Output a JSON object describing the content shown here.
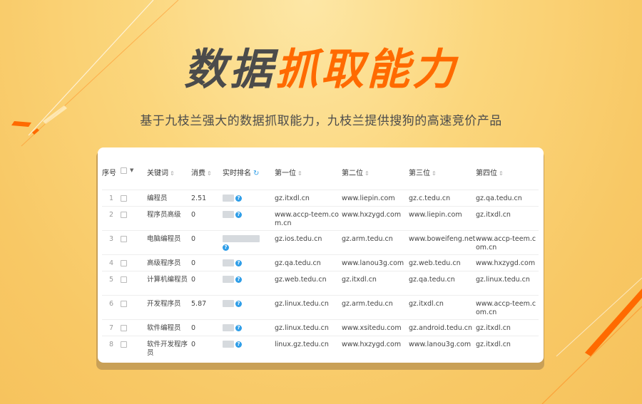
{
  "headline": {
    "dark": "数据",
    "orange": "抓取能力"
  },
  "subtitle": "基于九枝兰强大的数据抓取能力，九枝兰提供搜狗的高速竞价产品",
  "colors": {
    "accent": "#ff6a00",
    "info": "#2f9ee8",
    "card_shadow": "#c9a057"
  },
  "table": {
    "headers": {
      "index": "序号",
      "keyword": "关键词",
      "cost": "消费",
      "rank": "实时排名",
      "first": "第一位",
      "second": "第二位",
      "third": "第三位",
      "fourth": "第四位"
    },
    "sort_icon": "⇕",
    "refresh_icon": "refresh-icon",
    "question_icon": "question-icon",
    "rows": [
      {
        "index": "1",
        "keyword": "编程员",
        "cost": "2.51",
        "first": "gz.itxdl.cn",
        "second": "www.liepin.com",
        "third": "gz.c.tedu.cn",
        "fourth": "gz.qa.tedu.cn"
      },
      {
        "index": "2",
        "keyword": "程序员高级",
        "cost": "0",
        "first": "www.accp-teem.com.cn",
        "second": "www.hxzygd.com",
        "third": "www.liepin.com",
        "fourth": "gz.itxdl.cn"
      },
      {
        "index": "3",
        "keyword": "电脑编程员",
        "cost": "0",
        "first": "gz.ios.tedu.cn",
        "second": "gz.arm.tedu.cn",
        "third": "www.boweifeng.net",
        "fourth": "www.accp-teem.com.cn"
      },
      {
        "index": "4",
        "keyword": "高级程序员",
        "cost": "0",
        "first": "gz.qa.tedu.cn",
        "second": "www.lanou3g.com",
        "third": "gz.web.tedu.cn",
        "fourth": "www.hxzygd.com"
      },
      {
        "index": "5",
        "keyword": "计算机编程员",
        "cost": "0",
        "first": "gz.web.tedu.cn",
        "second": "gz.itxdl.cn",
        "third": "gz.qa.tedu.cn",
        "fourth": "gz.linux.tedu.cn"
      },
      {
        "index": "6",
        "keyword": "开发程序员",
        "cost": "5.87",
        "first": "gz.linux.tedu.cn",
        "second": "gz.arm.tedu.cn",
        "third": "gz.itxdl.cn",
        "fourth": "www.accp-teem.com.cn"
      },
      {
        "index": "7",
        "keyword": "软件编程员",
        "cost": "0",
        "first": "gz.linux.tedu.cn",
        "second": "www.xsitedu.com",
        "third": "gz.android.tedu.cn",
        "fourth": "gz.itxdl.cn"
      },
      {
        "index": "8",
        "keyword": "软件开发程序员",
        "cost": "0",
        "first": "linux.gz.tedu.cn",
        "second": "www.hxzygd.com",
        "third": "www.lanou3g.com",
        "fourth": "gz.itxdl.cn"
      }
    ]
  }
}
